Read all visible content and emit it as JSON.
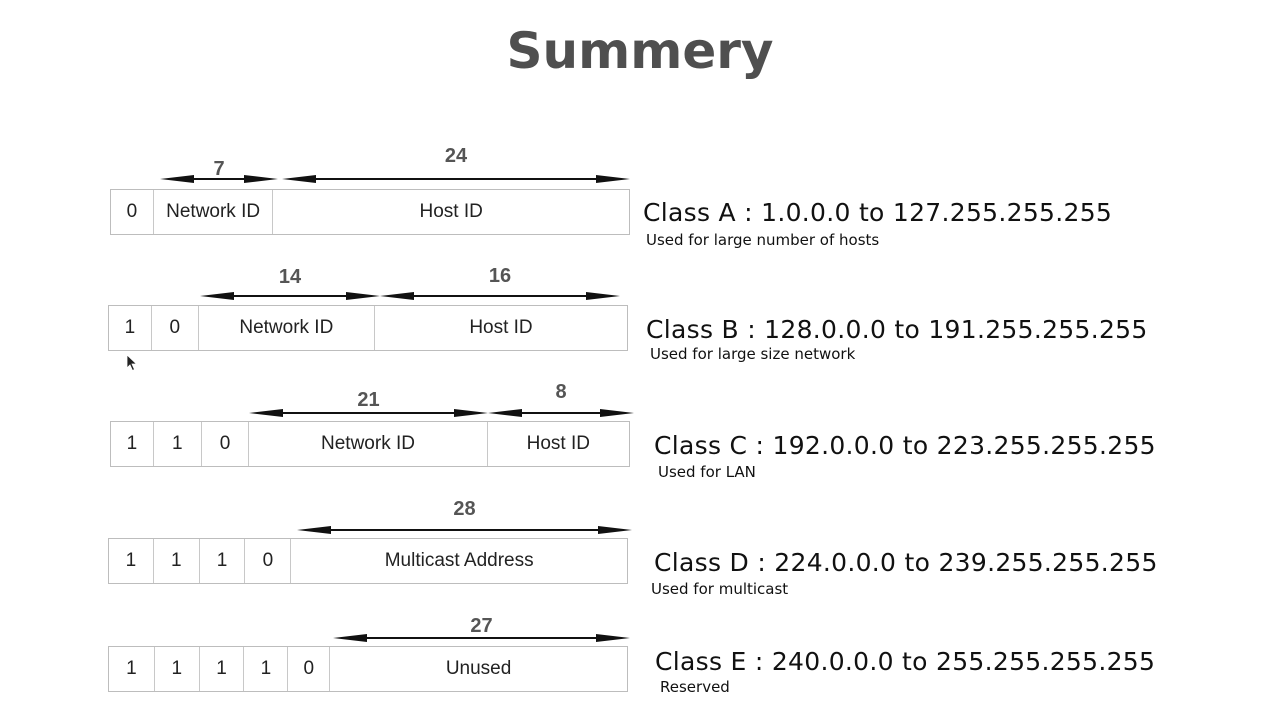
{
  "title": "Summery",
  "classes": [
    {
      "name": "Class A",
      "range_text": "Class A : 1.0.0.0 to 127.255.255.255",
      "usage": "Used for large number of hosts",
      "cells": [
        "0",
        "Network ID",
        "Host ID"
      ],
      "bit_spans": [
        {
          "label": "7",
          "field": "Network ID"
        },
        {
          "label": "24",
          "field": "Host ID"
        }
      ]
    },
    {
      "name": "Class B",
      "range_text": "Class B : 128.0.0.0 to 191.255.255.255",
      "usage": "Used for large size network",
      "cells": [
        "1",
        "0",
        "Network ID",
        "Host ID"
      ],
      "bit_spans": [
        {
          "label": "14",
          "field": "Network ID"
        },
        {
          "label": "16",
          "field": "Host ID"
        }
      ]
    },
    {
      "name": "Class C",
      "range_text": "Class C : 192.0.0.0 to 223.255.255.255",
      "usage": "Used for LAN",
      "cells": [
        "1",
        "1",
        "0",
        "Network ID",
        "Host ID"
      ],
      "bit_spans": [
        {
          "label": "21",
          "field": "Network ID"
        },
        {
          "label": "8",
          "field": "Host ID"
        }
      ]
    },
    {
      "name": "Class D",
      "range_text": "Class D : 224.0.0.0 to 239.255.255.255",
      "usage": "Used for multicast",
      "cells": [
        "1",
        "1",
        "1",
        "0",
        "Multicast Address"
      ],
      "bit_spans": [
        {
          "label": "28",
          "field": "Multicast Address"
        }
      ]
    },
    {
      "name": "Class E",
      "range_text": "Class E : 240.0.0.0 to 255.255.255.255",
      "usage": "Reserved",
      "cells": [
        "1",
        "1",
        "1",
        "1",
        "0",
        "Unused"
      ],
      "bit_spans": [
        {
          "label": "27",
          "field": "Unused"
        }
      ]
    }
  ],
  "colors": {
    "title": "#4f4f4f",
    "bit_label": "#555555",
    "cell_border": "#bdbdbd",
    "text": "#111111"
  }
}
